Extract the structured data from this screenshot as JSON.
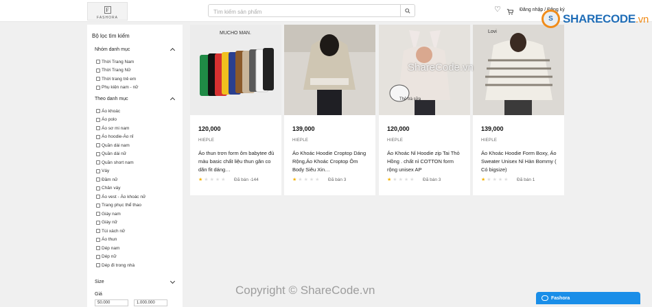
{
  "header": {
    "logo_letter": "F",
    "logo_text": "FASHORA",
    "search_placeholder": "Tìm kiếm sản phẩm",
    "login_text": "Đăng nhập / Đăng ký"
  },
  "sidebar": {
    "title": "Bộ lọc tìm kiếm",
    "group1_title": "Nhóm danh mục",
    "group1_items": [
      "Thời Trang Nam",
      "Thời Trang Nữ",
      "Thời trang trẻ em",
      "Phụ kiện nam - nữ"
    ],
    "group2_title": "Theo danh mục",
    "group2_items": [
      "Áo khoác",
      "Áo polo",
      "Áo sơ mi nam",
      "Áo hoodie-Áo nỉ",
      "Quần dài nam",
      "Quần dài nữ",
      "Quần short nam",
      "Váy",
      "Đầm nữ",
      "Chân váy",
      "Áo vest - Áo khoác nữ",
      "Trang phục thể thao",
      "Giày nam",
      "Giày nữ",
      "Túi xách nữ",
      "Áo thun",
      "Dép nam",
      "Dép nữ",
      "Dép đi trong nhà"
    ],
    "size_title": "Size",
    "price_title": "Giá",
    "price_min": "50.000",
    "price_max": "1.000.000"
  },
  "products": [
    {
      "price": "120,000",
      "brand": "HIEPLE",
      "name": "Áo thun trơn form ôm babytee đủ màu basic chất liệu thun gân co dãn fit dáng…",
      "rating": 1,
      "sold": "Đã bán -144",
      "image_text": "MUCHO MAN."
    },
    {
      "price": "139,000",
      "brand": "HIEPLE",
      "name": "Áo Khoác Hoodie Croptop Dáng Rộng,Áo Khoác Croptop Ôm Body Siêu Xin…",
      "rating": 1,
      "sold": "Đã bán 3",
      "image_text": ""
    },
    {
      "price": "120,000",
      "brand": "HIEPLE",
      "name": "Áo Khoác Nỉ Hoodie zip Tai Thỏ Hồng . chất nỉ COTTON form rộng unisex AP",
      "rating": 1,
      "sold": "Đã bán 3",
      "image_text": "Thỏ trà sữa"
    },
    {
      "price": "139,000",
      "brand": "HIEPLE",
      "name": "Áo Khoác Hoodie Form Boxy, Áo Sweater Unisex Nỉ Hàn Bommy ( Có bigsize)",
      "rating": 1,
      "sold": "Đã bán 1",
      "image_text": "Lovi"
    }
  ],
  "chat": {
    "label": "Fashora"
  },
  "watermarks": {
    "logo_icon": "S",
    "logo_main": "SHARECODE",
    "logo_domain": ".vn",
    "center": "ShareCode.vn",
    "bottom": "Copyright © ShareCode.vn"
  },
  "colors": {
    "accent": "#1a8ee8",
    "star": "#f5b301",
    "watermark_orange": "#f08c1a",
    "watermark_blue": "#1f6db7"
  }
}
